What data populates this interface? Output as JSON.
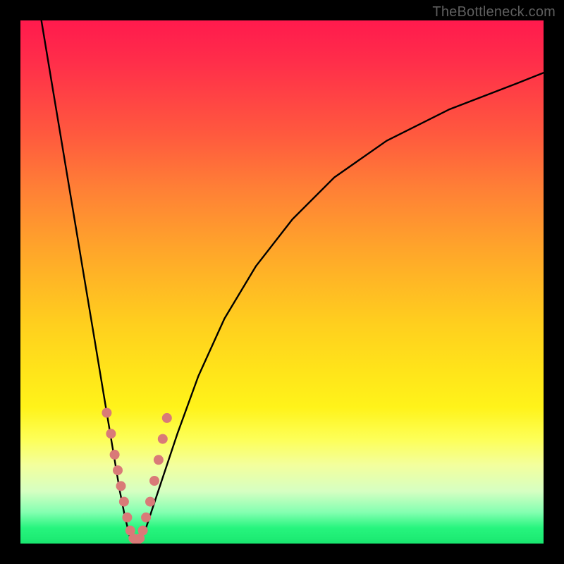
{
  "watermark": "TheBottleneck.com",
  "colors": {
    "frame": "#000000",
    "curve": "#000000",
    "markers": "#d97a78",
    "gradient_top": "#ff1a4d",
    "gradient_bottom": "#19e76f"
  },
  "chart_data": {
    "type": "line",
    "title": "",
    "xlabel": "",
    "ylabel": "",
    "xlim": [
      0,
      100
    ],
    "ylim": [
      0,
      100
    ],
    "grid": false,
    "legend": false,
    "note": "Bottleneck-style V curve. x is a normalized component ratio (0–100); y is bottleneck percentage (0–100, 0 = balanced at the dip). Values estimated from pixel positions.",
    "series": [
      {
        "name": "bottleneck_curve",
        "x": [
          4,
          6,
          8,
          10,
          12,
          14,
          16,
          18,
          19,
          20,
          21,
          22,
          23,
          24,
          25,
          27,
          30,
          34,
          39,
          45,
          52,
          60,
          70,
          82,
          95,
          100
        ],
        "y": [
          100,
          88,
          76,
          64,
          52,
          40,
          28,
          16,
          10,
          5,
          1,
          0,
          1,
          3,
          6,
          12,
          21,
          32,
          43,
          53,
          62,
          70,
          77,
          83,
          88,
          90
        ]
      }
    ],
    "markers": {
      "name": "highlighted_points",
      "note": "Salmon dots clustered near the dip of the V.",
      "x": [
        16.5,
        17.3,
        18.0,
        18.6,
        19.2,
        19.8,
        20.4,
        21.0,
        21.6,
        22.2,
        22.8,
        23.4,
        24.0,
        24.8,
        25.6,
        26.4,
        27.2,
        28.0
      ],
      "y": [
        25,
        21,
        17,
        14,
        11,
        8,
        5,
        2.5,
        1,
        0.5,
        1,
        2.5,
        5,
        8,
        12,
        16,
        20,
        24
      ]
    }
  }
}
